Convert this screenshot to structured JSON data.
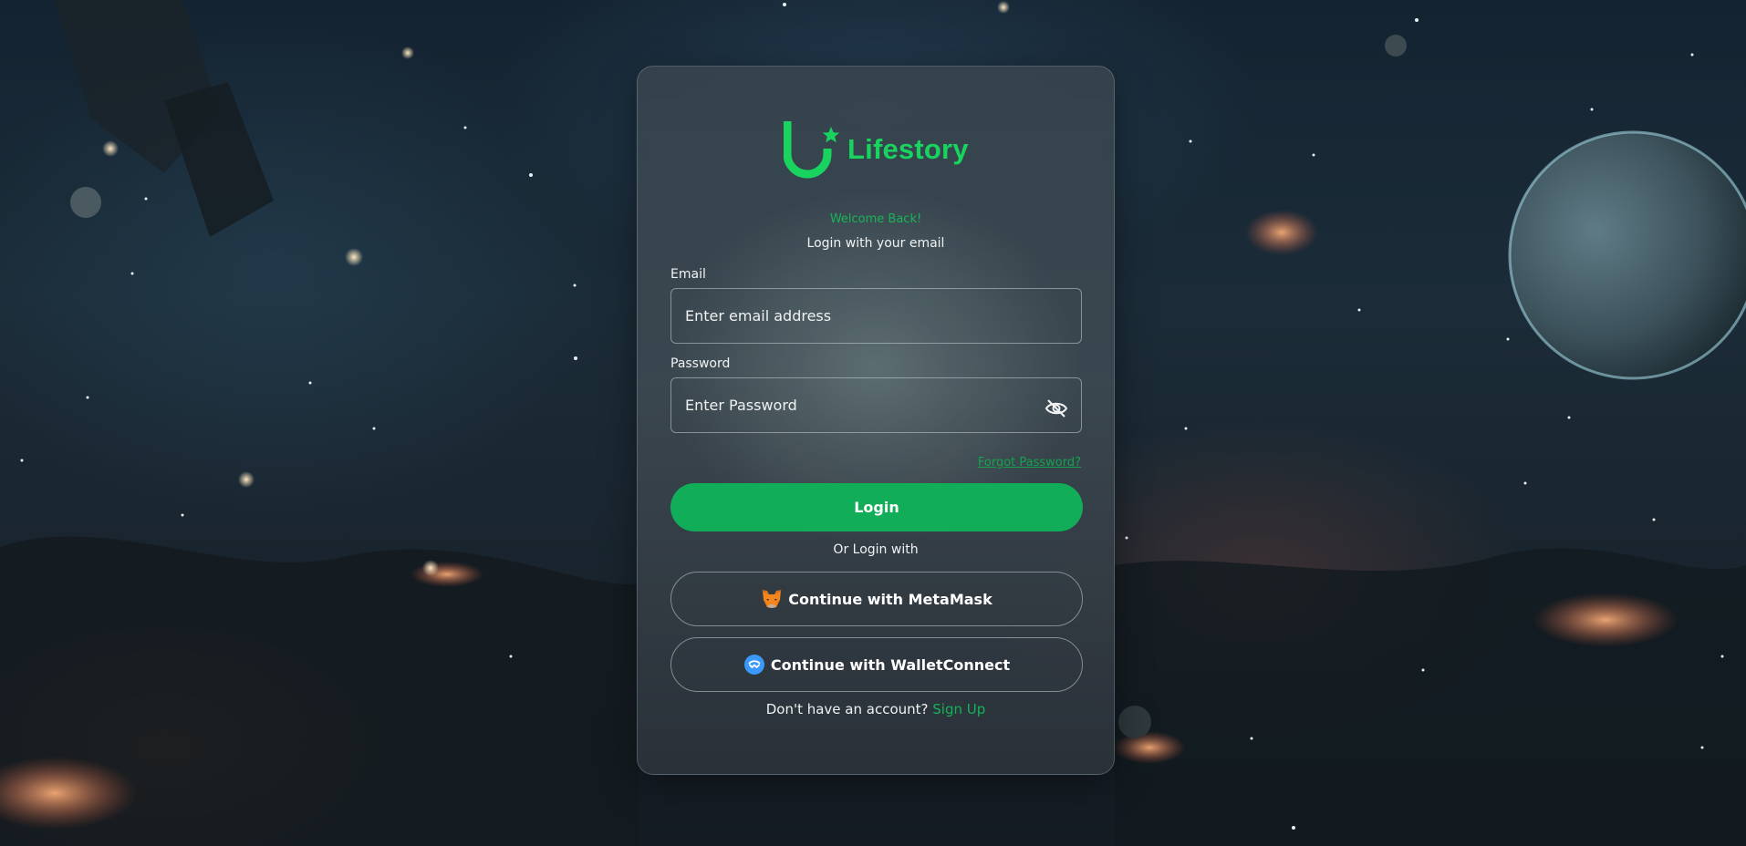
{
  "brand": {
    "name": "Lifestory",
    "accent_color": "#18d45e",
    "button_color": "#12ad58"
  },
  "login": {
    "welcome": "Welcome Back!",
    "subtitle": "Login with your email",
    "email_label": "Email",
    "email_placeholder": "Enter email address",
    "password_label": "Password",
    "password_placeholder": "Enter Password",
    "password_toggle_icon": "eye-off-icon",
    "forgot_link": "Forgot Password?",
    "login_button": "Login",
    "or_text": "Or Login with",
    "metamask_button": "Continue with MetaMask",
    "walletconnect_button": "Continue with WalletConnect",
    "no_account_text": "Don't have an account?",
    "signup_link": "Sign Up"
  },
  "background": {
    "description_icon": "space-nebula-background"
  }
}
